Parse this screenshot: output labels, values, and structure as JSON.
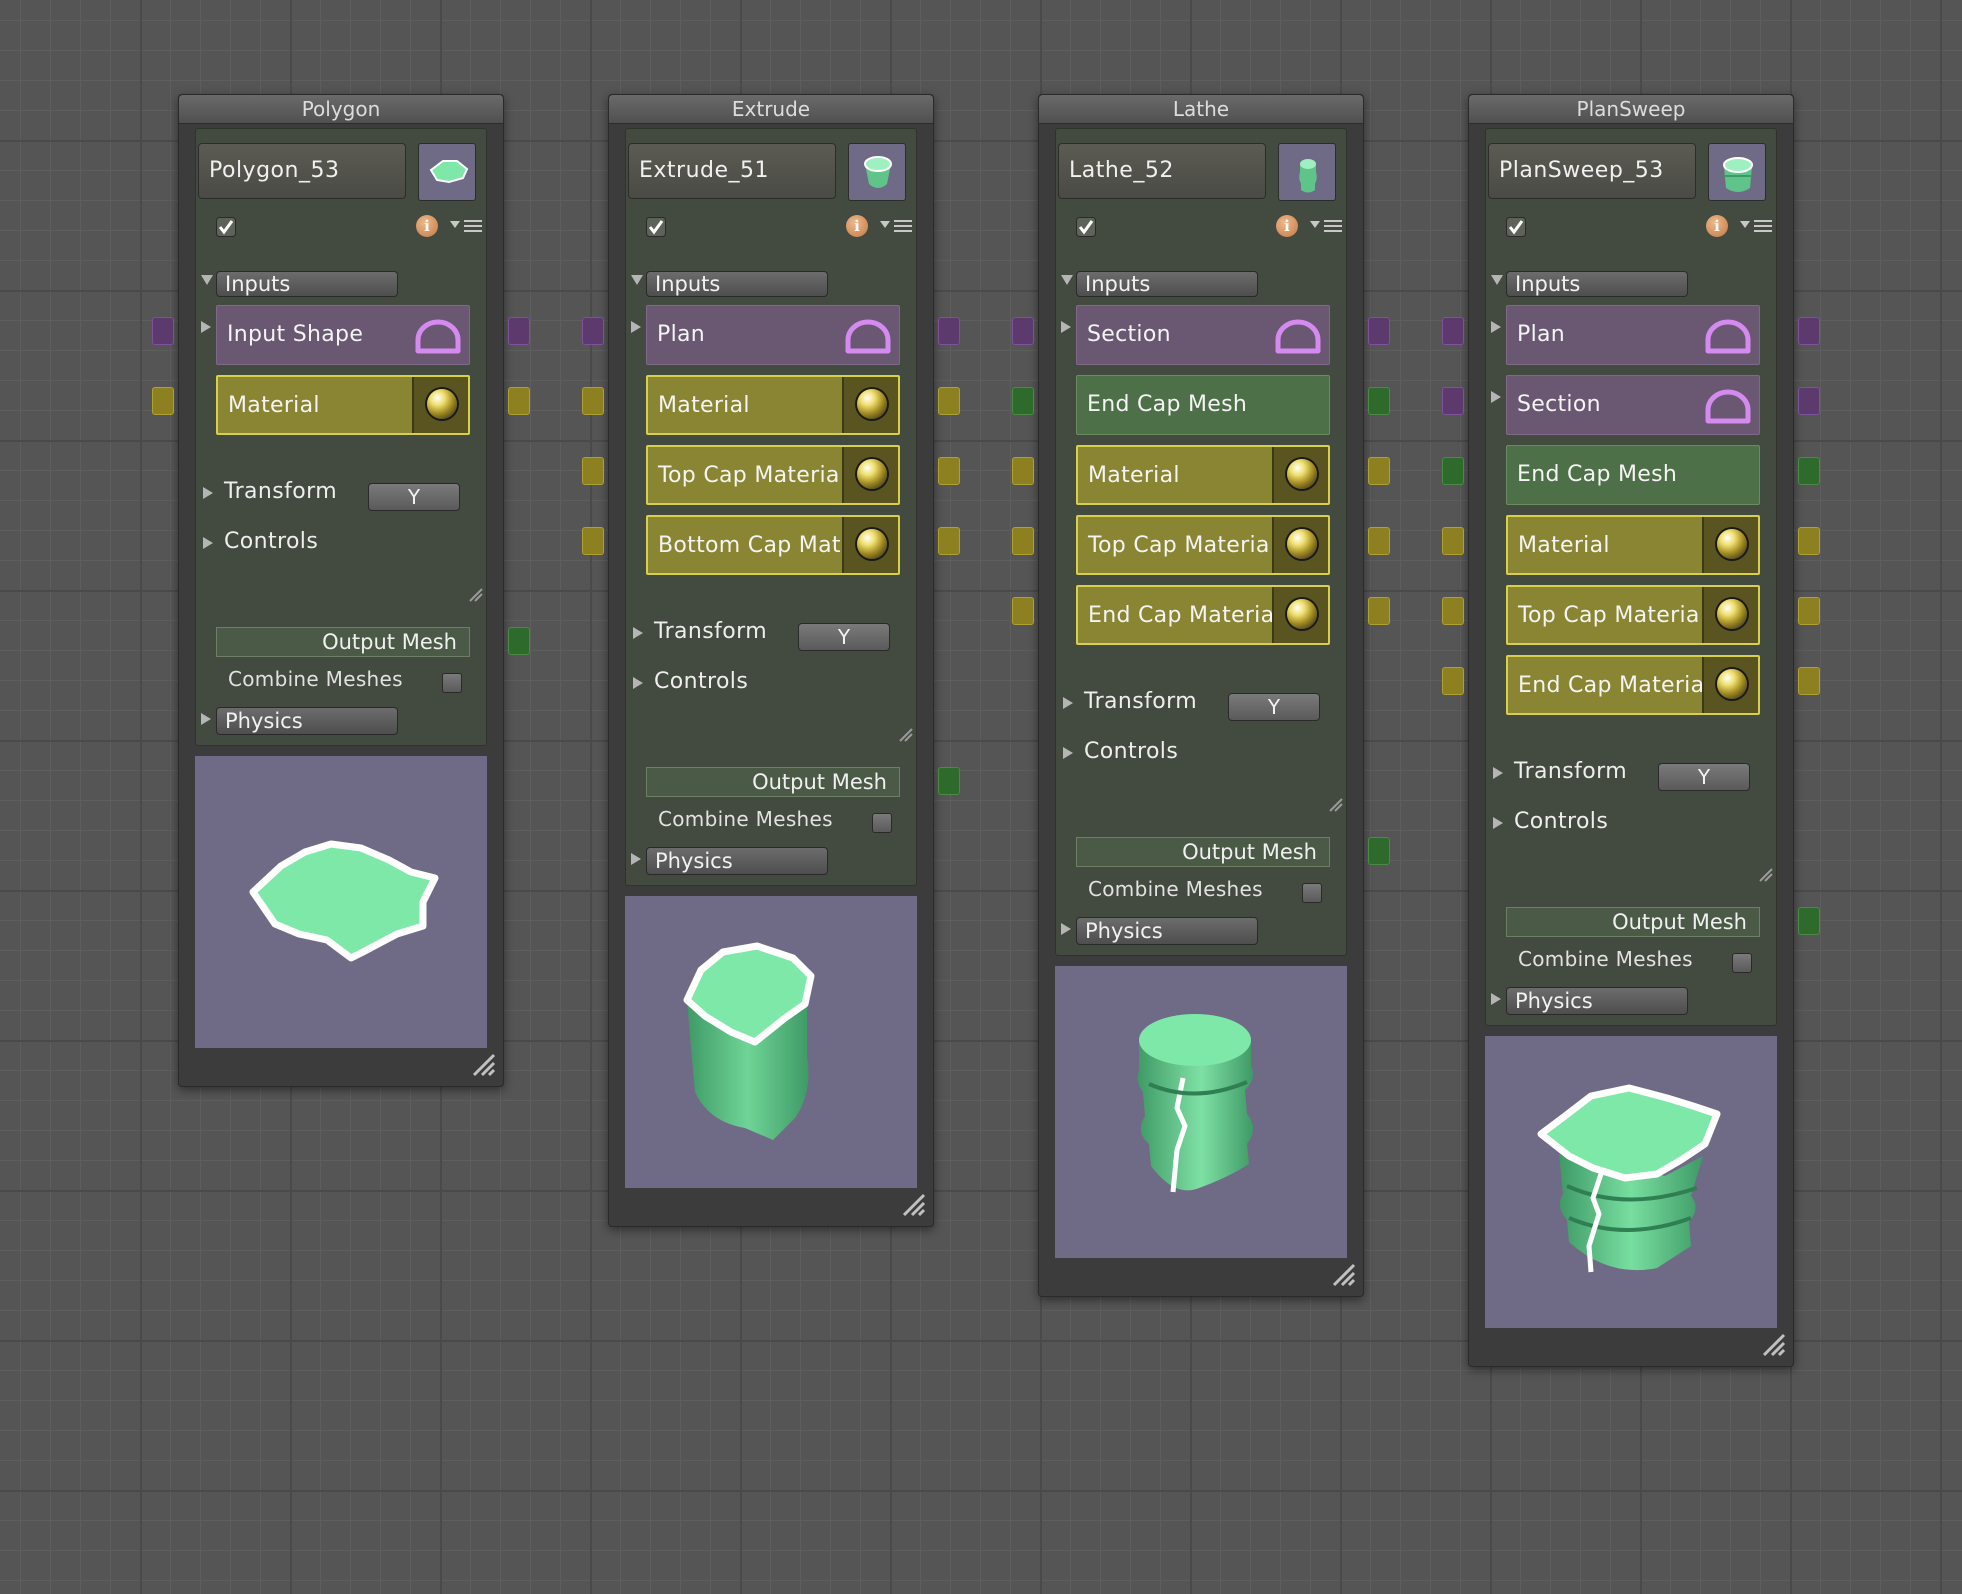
{
  "nodes": [
    {
      "title": "Polygon",
      "name": "Polygon_53",
      "inputs_label": "Inputs",
      "ports": [
        {
          "label": "Input Shape",
          "type": "shape",
          "icon": "arc-icon"
        },
        {
          "label": "Material",
          "type": "material",
          "icon": "material-ball-icon"
        }
      ],
      "transform_label": "Transform",
      "axis": "Y",
      "controls_label": "Controls",
      "output_label": "Output Mesh",
      "combine_label": "Combine Meshes",
      "physics_label": "Physics"
    },
    {
      "title": "Extrude",
      "name": "Extrude_51",
      "inputs_label": "Inputs",
      "ports": [
        {
          "label": "Plan",
          "type": "shape",
          "icon": "arc-icon"
        },
        {
          "label": "Material",
          "type": "material",
          "icon": "material-ball-icon"
        },
        {
          "label": "Top Cap Materia",
          "type": "material",
          "icon": "material-ball-icon"
        },
        {
          "label": "Bottom Cap Mate",
          "type": "material",
          "icon": "material-ball-icon"
        }
      ],
      "transform_label": "Transform",
      "axis": "Y",
      "controls_label": "Controls",
      "output_label": "Output Mesh",
      "combine_label": "Combine Meshes",
      "physics_label": "Physics"
    },
    {
      "title": "Lathe",
      "name": "Lathe_52",
      "inputs_label": "Inputs",
      "ports": [
        {
          "label": "Section",
          "type": "shape",
          "icon": "arc-icon"
        },
        {
          "label": "End Cap Mesh",
          "type": "mesh",
          "icon": ""
        },
        {
          "label": "Material",
          "type": "material",
          "icon": "material-ball-icon"
        },
        {
          "label": "Top Cap Materia",
          "type": "material",
          "icon": "material-ball-icon"
        },
        {
          "label": "End Cap Materia",
          "type": "material",
          "icon": "material-ball-icon"
        }
      ],
      "transform_label": "Transform",
      "axis": "Y",
      "controls_label": "Controls",
      "output_label": "Output Mesh",
      "combine_label": "Combine Meshes",
      "physics_label": "Physics"
    },
    {
      "title": "PlanSweep",
      "name": "PlanSweep_53",
      "inputs_label": "Inputs",
      "ports": [
        {
          "label": "Plan",
          "type": "shape",
          "icon": "arc-icon"
        },
        {
          "label": "Section",
          "type": "shape",
          "icon": "arc-icon"
        },
        {
          "label": "End Cap Mesh",
          "type": "mesh",
          "icon": ""
        },
        {
          "label": "Material",
          "type": "material",
          "icon": "material-ball-icon"
        },
        {
          "label": "Top Cap Materia",
          "type": "material",
          "icon": "material-ball-icon"
        },
        {
          "label": "End Cap Materia",
          "type": "material",
          "icon": "material-ball-icon"
        }
      ],
      "transform_label": "Transform",
      "axis": "Y",
      "controls_label": "Controls",
      "output_label": "Output Mesh",
      "combine_label": "Combine Meshes",
      "physics_label": "Physics"
    }
  ],
  "colors": {
    "shape_port": "#6a5873",
    "mesh_port": "#4e7048",
    "material_port": "#8a8532",
    "preview_bg": "#6f6b87",
    "mesh_green": "#7de8a8"
  }
}
